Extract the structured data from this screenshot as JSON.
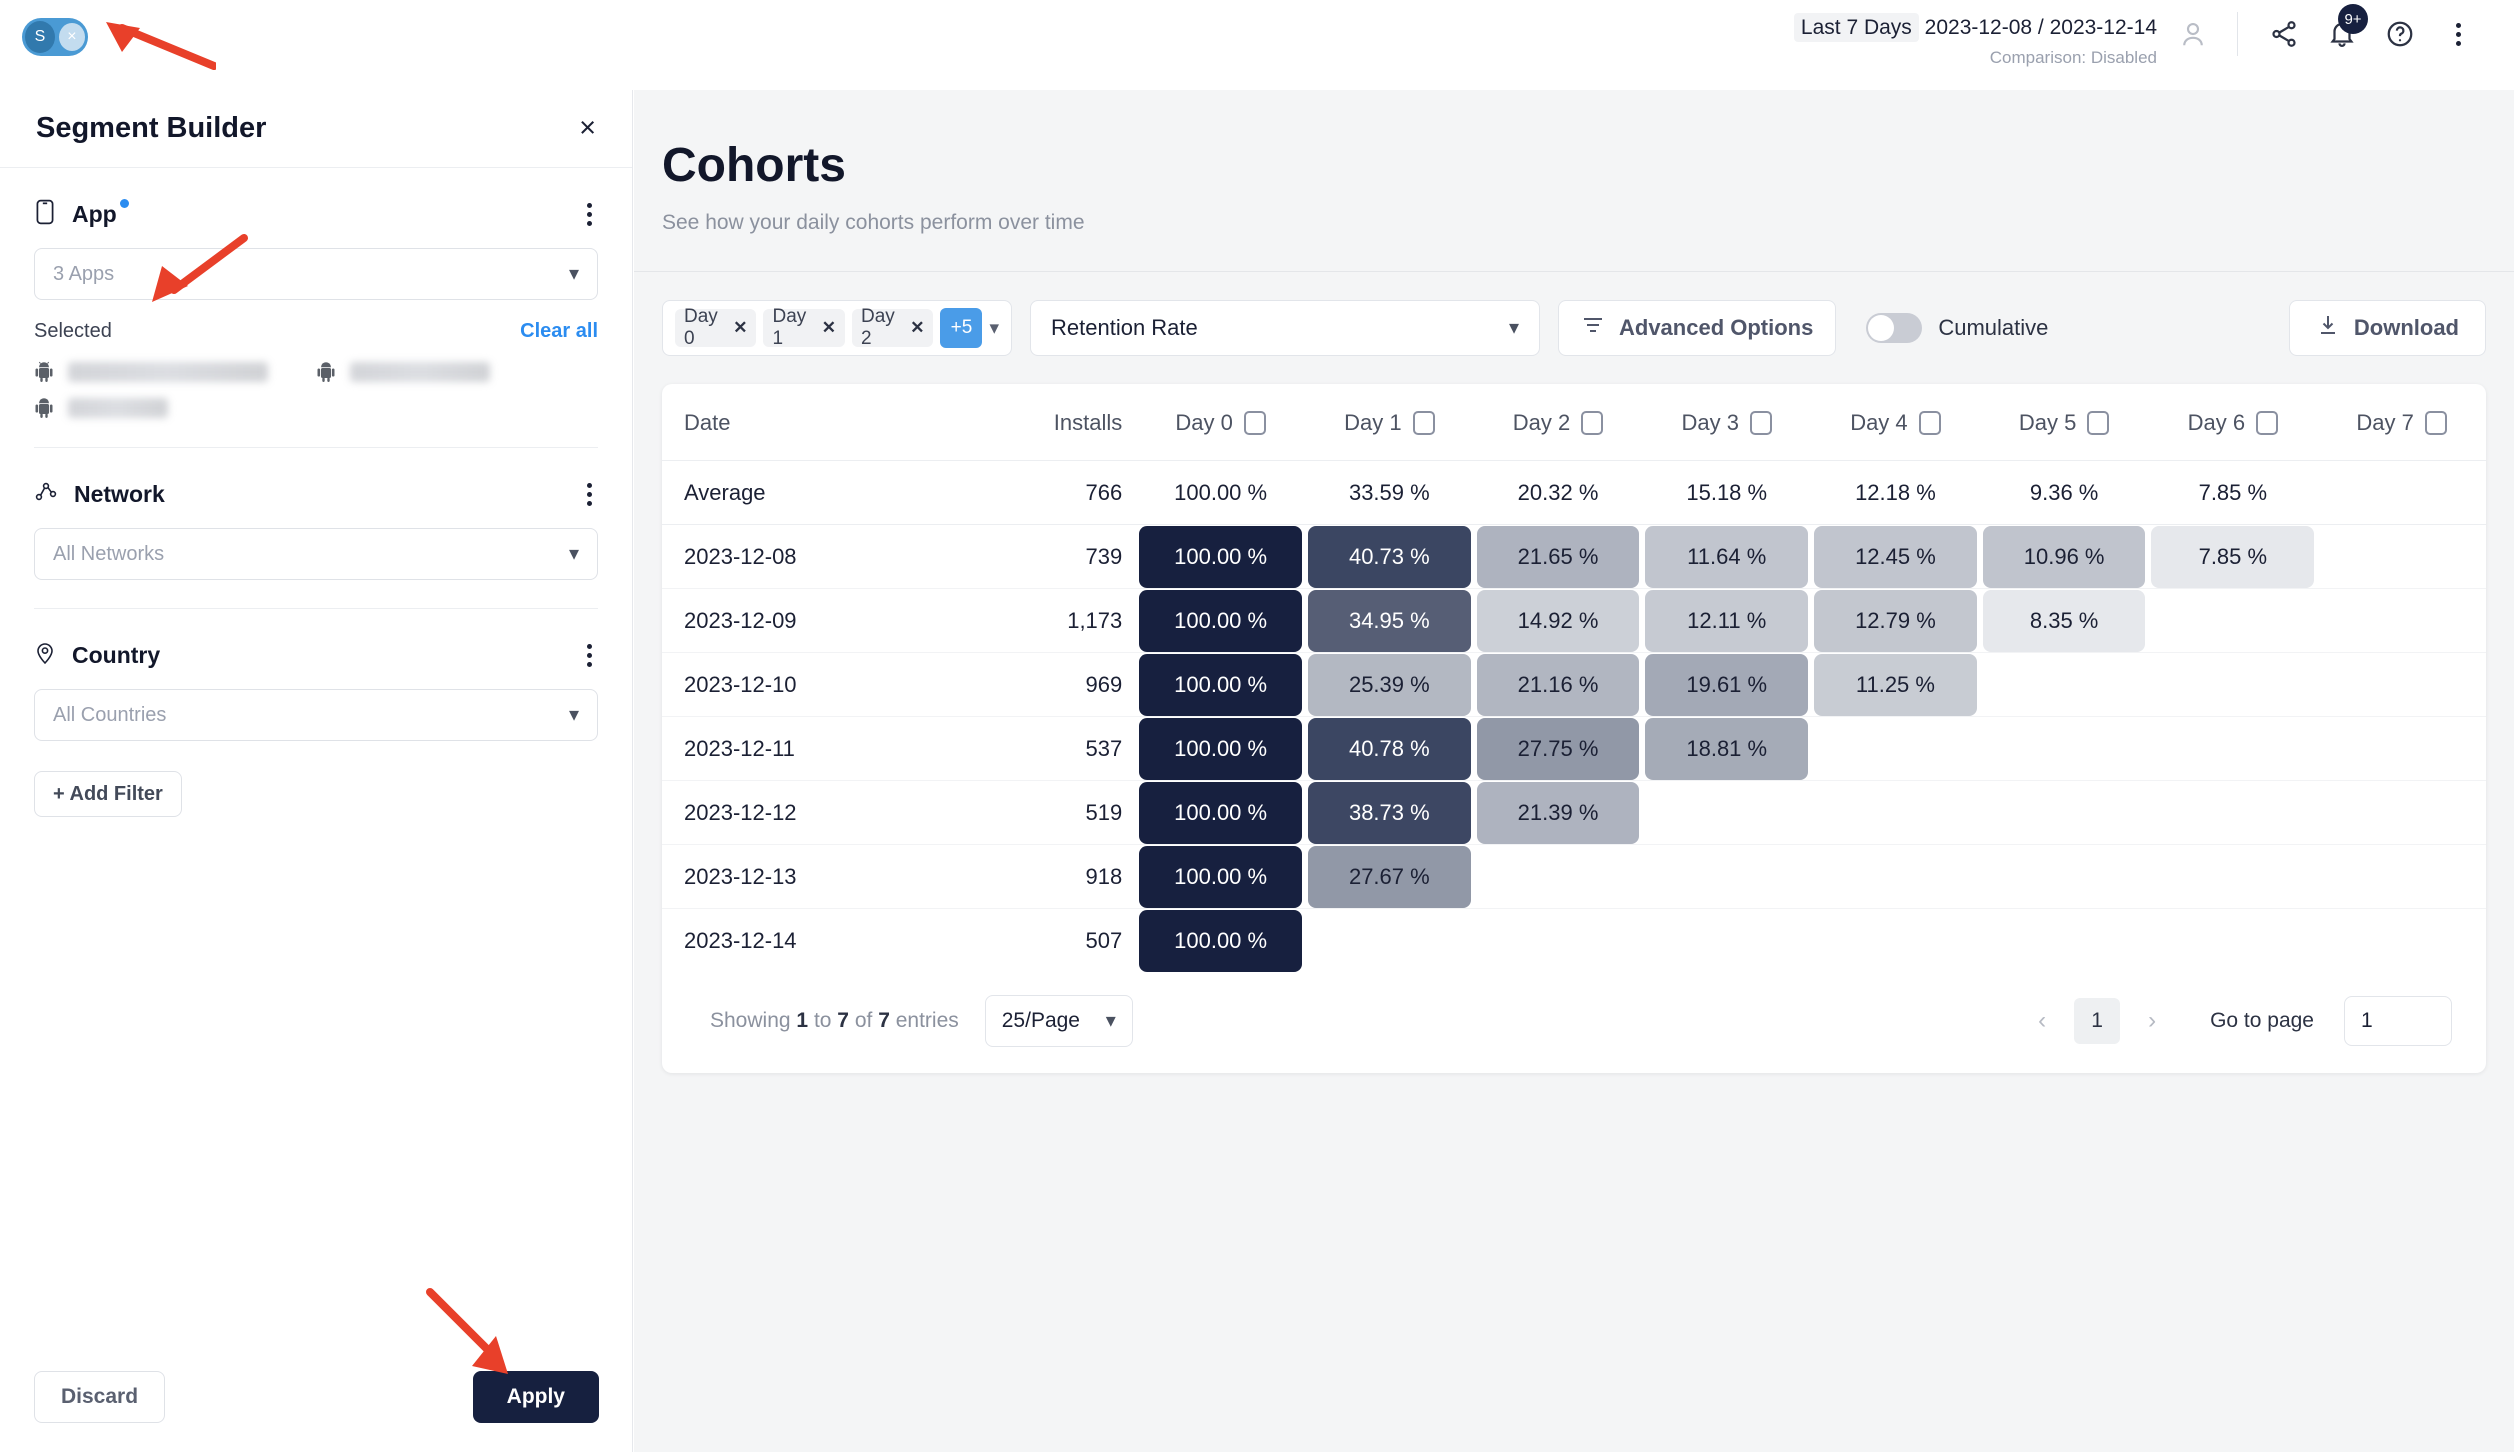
{
  "topbar": {
    "segment_chip": {
      "letter": "S",
      "close": "×"
    },
    "date_preset": "Last 7 Days",
    "date_range": "2023-12-08 / 2023-12-14",
    "comparison": "Comparison: Disabled",
    "notification_badge": "9+",
    "icons": [
      "users-icon",
      "share-icon",
      "bell-icon",
      "help-icon",
      "kebab-menu-icon"
    ]
  },
  "sidebar": {
    "title": "Segment Builder",
    "close_label": "×",
    "app": {
      "title": "App",
      "select_value": "3 Apps",
      "selected_label": "Selected",
      "clear_all": "Clear all",
      "selected_apps": [
        "",
        "",
        ""
      ]
    },
    "network": {
      "title": "Network",
      "select_value": "All Networks"
    },
    "country": {
      "title": "Country",
      "select_value": "All Countries"
    },
    "add_filter": "+  Add Filter",
    "discard": "Discard",
    "apply": "Apply"
  },
  "main": {
    "title": "Cohorts",
    "subtitle": "See how your daily cohorts perform over time",
    "toolbar": {
      "chips": [
        "Day 0",
        "Day 1",
        "Day 2"
      ],
      "chips_more": "+5",
      "metric": "Retention Rate",
      "advanced_options": "Advanced Options",
      "cumulative": "Cumulative",
      "cumulative_on": false,
      "download": "Download"
    },
    "footer": {
      "showing_prefix": "Showing",
      "showing_from": "1",
      "showing_to_word": "to",
      "showing_to": "7",
      "showing_of_word": "of",
      "showing_total": "7",
      "showing_suffix": "entries",
      "per_page": "25/Page",
      "prev": "‹",
      "next": "›",
      "current_page": "1",
      "goto_label": "Go to page",
      "goto_value": "1"
    }
  },
  "chart_data": {
    "type": "heatmap",
    "title": "Cohorts",
    "subtitle": "See how your daily cohorts perform over time",
    "metric": "Retention Rate",
    "columns": [
      "Date",
      "Installs",
      "Day 0",
      "Day 1",
      "Day 2",
      "Day 3",
      "Day 4",
      "Day 5",
      "Day 6",
      "Day 7"
    ],
    "day_columns": [
      "Day 0",
      "Day 1",
      "Day 2",
      "Day 3",
      "Day 4",
      "Day 5",
      "Day 6",
      "Day 7"
    ],
    "average_row": {
      "label": "Average",
      "installs": "766",
      "values": [
        "100.00 %",
        "33.59 %",
        "20.32 %",
        "15.18 %",
        "12.18 %",
        "9.36 %",
        "7.85 %",
        ""
      ]
    },
    "rows": [
      {
        "date": "2023-12-08",
        "installs": "739",
        "values": [
          "100.00 %",
          "40.73 %",
          "21.65 %",
          "11.64 %",
          "12.45 %",
          "10.96 %",
          "7.85 %",
          ""
        ],
        "colors": [
          "#17203f",
          "#3b4662",
          "#aeb3bf",
          "#c1c5ce",
          "#c1c5ce",
          "#c0c4cd",
          "#e6e8ec",
          ""
        ]
      },
      {
        "date": "2023-12-09",
        "installs": "1,173",
        "values": [
          "100.00 %",
          "34.95 %",
          "14.92 %",
          "12.11 %",
          "12.79 %",
          "8.35 %",
          "",
          ""
        ],
        "colors": [
          "#17203f",
          "#565e75",
          "#ccd0d7",
          "#c6cad2",
          "#c3c7cf",
          "#e6e8ec",
          "",
          ""
        ]
      },
      {
        "date": "2023-12-10",
        "installs": "969",
        "values": [
          "100.00 %",
          "25.39 %",
          "21.16 %",
          "19.61 %",
          "11.25 %",
          "",
          "",
          ""
        ],
        "colors": [
          "#17203f",
          "#b3b8c2",
          "#b1b6c1",
          "#a3a9b6",
          "#c8ccd3",
          "",
          "",
          ""
        ]
      },
      {
        "date": "2023-12-11",
        "installs": "537",
        "values": [
          "100.00 %",
          "40.78 %",
          "27.75 %",
          "18.81 %",
          "",
          "",
          "",
          ""
        ],
        "colors": [
          "#17203f",
          "#3b4662",
          "#9198a7",
          "#a5abb7",
          "",
          "",
          "",
          ""
        ]
      },
      {
        "date": "2023-12-12",
        "installs": "519",
        "values": [
          "100.00 %",
          "38.73 %",
          "21.39 %",
          "",
          "",
          "",
          "",
          ""
        ],
        "colors": [
          "#17203f",
          "#3d4763",
          "#aeb3bf",
          "",
          "",
          "",
          "",
          ""
        ]
      },
      {
        "date": "2023-12-13",
        "installs": "918",
        "values": [
          "100.00 %",
          "27.67 %",
          "",
          "",
          "",
          "",
          "",
          ""
        ],
        "colors": [
          "#17203f",
          "#9198a7",
          "",
          "",
          "",
          "",
          "",
          ""
        ]
      },
      {
        "date": "2023-12-14",
        "installs": "507",
        "values": [
          "100.00 %",
          "",
          "",
          "",
          "",
          "",
          "",
          ""
        ],
        "colors": [
          "#17203f",
          "",
          "",
          "",
          "",
          "",
          "",
          ""
        ]
      }
    ]
  }
}
